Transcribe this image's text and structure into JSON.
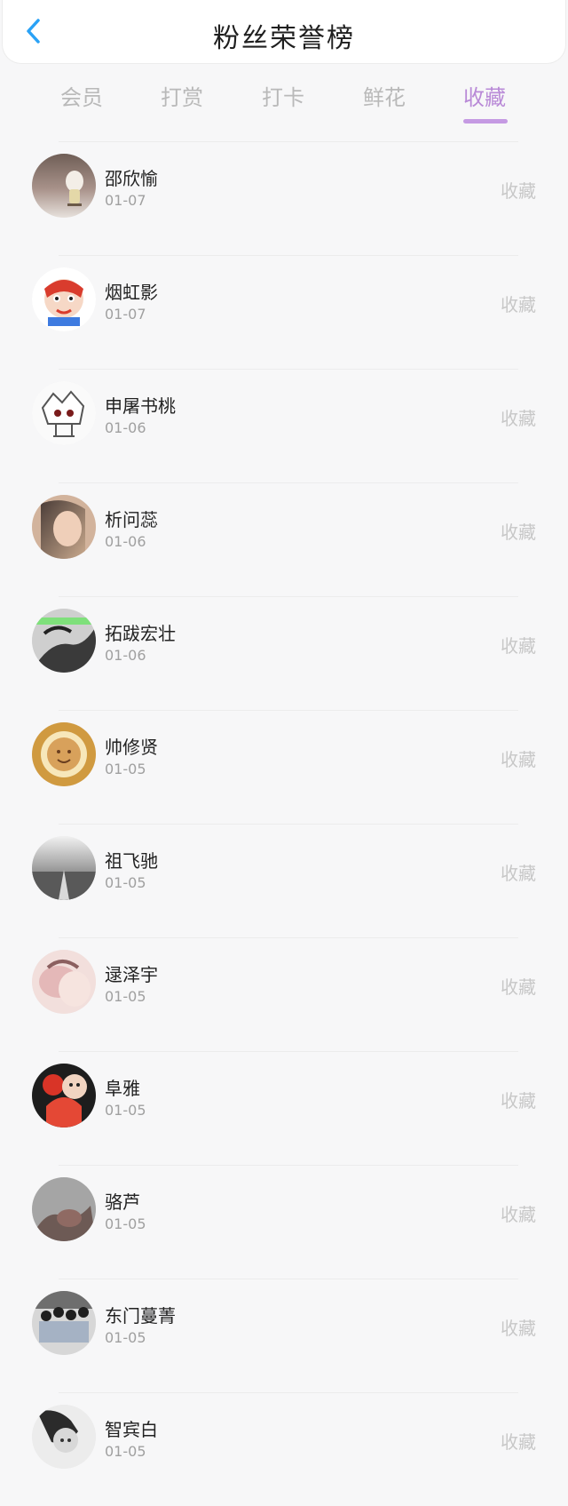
{
  "header": {
    "title": "粉丝荣誉榜"
  },
  "tabs": [
    {
      "label": "会员"
    },
    {
      "label": "打赏"
    },
    {
      "label": "打卡"
    },
    {
      "label": "鲜花"
    },
    {
      "label": "收藏"
    }
  ],
  "list": [
    {
      "name": "邵欣愉",
      "date": "01-07",
      "action": "收藏"
    },
    {
      "name": "烟虹影",
      "date": "01-07",
      "action": "收藏"
    },
    {
      "name": "申屠书桃",
      "date": "01-06",
      "action": "收藏"
    },
    {
      "name": "析问蕊",
      "date": "01-06",
      "action": "收藏"
    },
    {
      "name": "拓跋宏壮",
      "date": "01-06",
      "action": "收藏"
    },
    {
      "name": "帅修贤",
      "date": "01-05",
      "action": "收藏"
    },
    {
      "name": "祖飞驰",
      "date": "01-05",
      "action": "收藏"
    },
    {
      "name": "逯泽宇",
      "date": "01-05",
      "action": "收藏"
    },
    {
      "name": "阜雅",
      "date": "01-05",
      "action": "收藏"
    },
    {
      "name": "骆芦",
      "date": "01-05",
      "action": "收藏"
    },
    {
      "name": "东门蔓菁",
      "date": "01-05",
      "action": "收藏"
    },
    {
      "name": "智宾白",
      "date": "01-05",
      "action": "收藏"
    }
  ]
}
